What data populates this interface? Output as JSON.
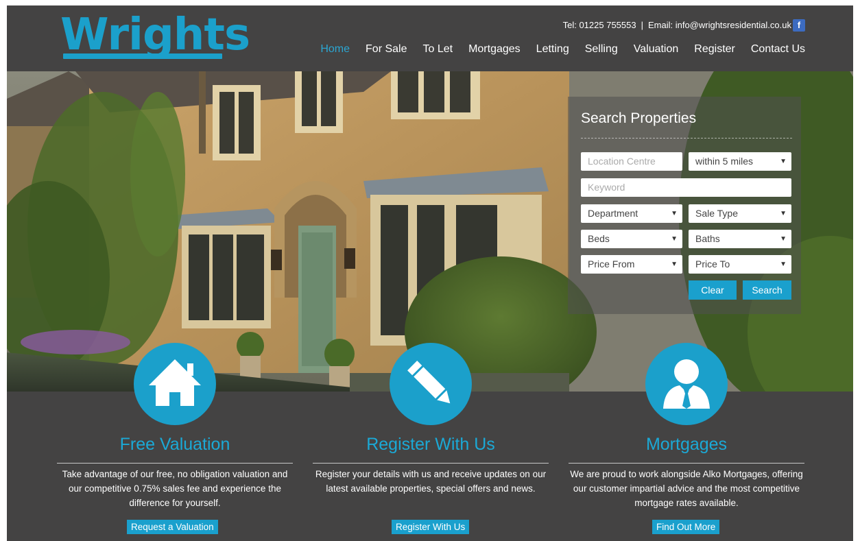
{
  "header": {
    "logo_text": "Wrights",
    "contact_tel": "Tel: 01225 755553",
    "contact_sep": "|",
    "contact_email": "Email: info@wrightsresidential.co.uk",
    "social_icon": "facebook-icon",
    "social_glyph": "f",
    "nav": [
      {
        "label": "Home",
        "active": true
      },
      {
        "label": "For Sale"
      },
      {
        "label": "To Let"
      },
      {
        "label": "Mortgages"
      },
      {
        "label": "Letting"
      },
      {
        "label": "Selling"
      },
      {
        "label": "Valuation"
      },
      {
        "label": "Register"
      },
      {
        "label": "Contact Us"
      }
    ]
  },
  "search": {
    "title": "Search Properties",
    "location_placeholder": "Location Centre",
    "radius_selected": "within 5 miles",
    "keyword_placeholder": "Keyword",
    "department_selected": "Department",
    "sale_type_selected": "Sale Type",
    "beds_selected": "Beds",
    "baths_selected": "Baths",
    "price_from_selected": "Price From",
    "price_to_selected": "Price To",
    "caret_glyph": "▼",
    "clear_label": "Clear",
    "search_label": "Search"
  },
  "features": [
    {
      "icon": "house-icon",
      "title": "Free Valuation",
      "text": "Take advantage of our free, no obligation valuation and our competitive 0.75% sales fee and experience the difference for yourself.",
      "button": "Request a Valuation"
    },
    {
      "icon": "pencil-icon",
      "title": "Register With Us",
      "text": "Register your details with us and receive updates on our latest available properties, special offers and news.",
      "button": "Register With Us"
    },
    {
      "icon": "person-icon",
      "title": "Mortgages",
      "text": "We are proud to work alongside Alko Mortgages, offering our customer impartial advice and the most competitive mortgage rates available.",
      "button": "Find Out More"
    }
  ],
  "colors": {
    "accent": "#1ba0cb",
    "background": "#444343",
    "text": "#ffffff"
  }
}
